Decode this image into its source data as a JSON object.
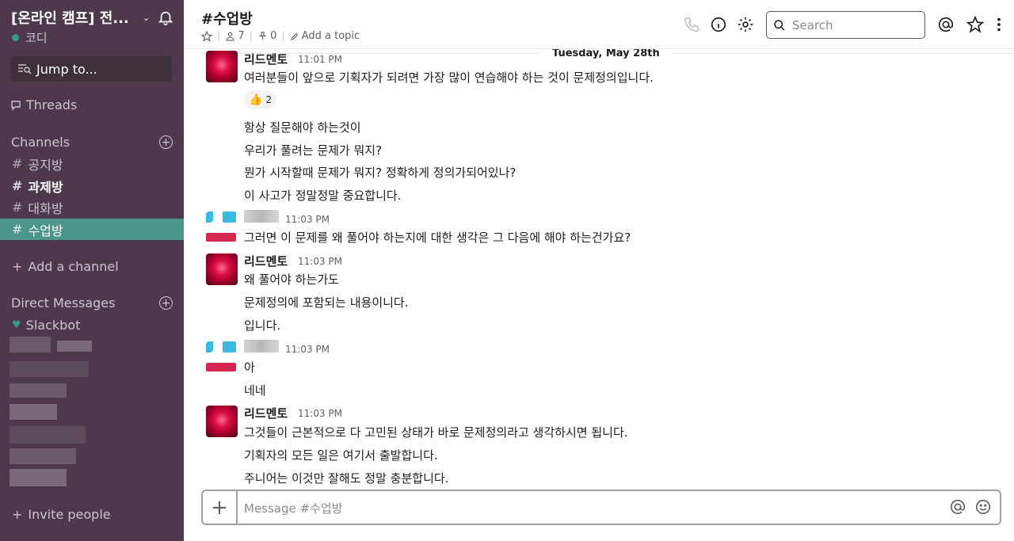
{
  "sidebar": {
    "workspace_name": "[온라인 캠프] 전...",
    "user_name": "코디",
    "jump_label": "Jump to...",
    "threads_label": "Threads",
    "channels_label": "Channels",
    "channels": [
      {
        "name": "공지방",
        "bold": false,
        "active": false
      },
      {
        "name": "과제방",
        "bold": true,
        "active": false
      },
      {
        "name": "대화방",
        "bold": false,
        "active": false
      },
      {
        "name": "수업방",
        "bold": false,
        "active": true
      }
    ],
    "add_channel_label": "Add a channel",
    "dm_label": "Direct Messages",
    "dms": [
      {
        "name": "Slackbot"
      }
    ],
    "invite_label": "Invite people"
  },
  "header": {
    "channel_title": "#수업방",
    "member_count": "7",
    "pinned_count": "0",
    "add_topic_label": "Add a topic",
    "search_placeholder": "Search"
  },
  "date_divider": "Tuesday, May 28th",
  "messages": [
    {
      "author": "리드멘토",
      "time": "11:01 PM",
      "lines": [
        "여러분들이 앞으로 기획자가 되려면 가장 많이 연습해야 하는 것이 문제정의입니다."
      ],
      "reaction": {
        "emoji": "👍",
        "count": "2"
      }
    },
    {
      "author": "",
      "time": "",
      "lines": [
        "항상 질문해야 하는것이",
        "우리가 풀려는 문제가 뭐지?",
        "뭔가 시작할때 문제가 뭐지? 정확하게 정의가되어있나?",
        "이 사고가 정말정말 중요합니다."
      ]
    },
    {
      "author": "",
      "time": "11:03 PM",
      "lines": [
        "그러면 이 문제를 왜 풀어야 하는지에 대한 생각은 그 다음에 해야 하는건가요?"
      ]
    },
    {
      "author": "리드멘토",
      "time": "11:03 PM",
      "lines": [
        "왜 풀어야 하는가도",
        "문제정의에 포함되는 내용이니다.",
        "입니다."
      ]
    },
    {
      "author": "",
      "time": "11:03 PM",
      "lines": [
        "아",
        "네네"
      ]
    },
    {
      "author": "리드멘토",
      "time": "11:03 PM",
      "lines": [
        "그것들이 근본적으로 다 고민된 상태가 바로 문제정의라고 생각하시면 됩니다.",
        "기획자의 모든 일은 여기서 출발합니다.",
        "주니어는 이것만 잘해도 정말 충분합니다."
      ]
    }
  ],
  "composer": {
    "placeholder": "Message #수업방"
  },
  "colors": {
    "sidebar_bg": "#4d394b",
    "active_channel": "#4c9689",
    "presence": "#38978d"
  }
}
